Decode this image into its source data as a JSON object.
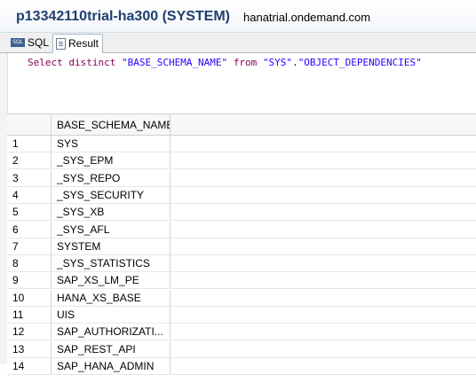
{
  "title": {
    "main": "p13342110trial-ha300 (SYSTEM)",
    "host": "hanatrial.ondemand.com"
  },
  "tabs": [
    {
      "label": "SQL",
      "icon": "sql-icon"
    },
    {
      "label": "Result",
      "icon": "result-icon"
    }
  ],
  "sql": {
    "kw_select": "Select distinct",
    "str_col": "\"BASE_SCHEMA_NAME\"",
    "kw_from": "from",
    "str_schema": "\"SYS\"",
    "dot": ".",
    "str_table": "\"OBJECT_DEPENDENCIES\""
  },
  "result": {
    "column_header": "BASE_SCHEMA_NAME",
    "rows": [
      {
        "n": "1",
        "v": "SYS"
      },
      {
        "n": "2",
        "v": "_SYS_EPM"
      },
      {
        "n": "3",
        "v": "_SYS_REPO"
      },
      {
        "n": "4",
        "v": "_SYS_SECURITY"
      },
      {
        "n": "5",
        "v": "_SYS_XB"
      },
      {
        "n": "6",
        "v": "_SYS_AFL"
      },
      {
        "n": "7",
        "v": "SYSTEM"
      },
      {
        "n": "8",
        "v": "_SYS_STATISTICS"
      },
      {
        "n": "9",
        "v": "SAP_XS_LM_PE"
      },
      {
        "n": "10",
        "v": "HANA_XS_BASE"
      },
      {
        "n": "11",
        "v": "UIS"
      },
      {
        "n": "12",
        "v": "SAP_AUTHORIZATI..."
      },
      {
        "n": "13",
        "v": "SAP_REST_API"
      },
      {
        "n": "14",
        "v": "SAP_HANA_ADMIN"
      }
    ]
  }
}
